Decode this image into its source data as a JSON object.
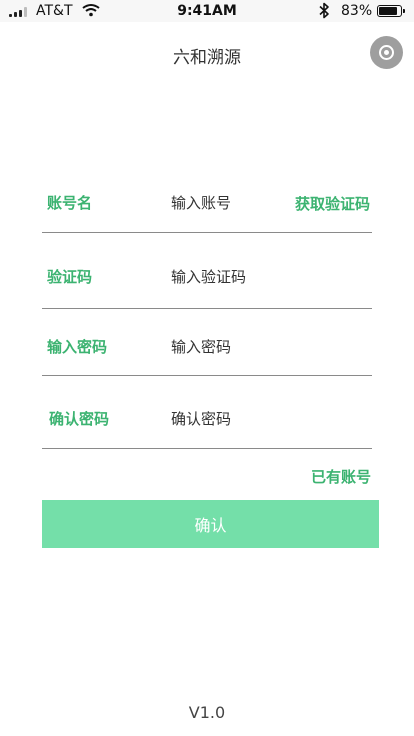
{
  "status_bar": {
    "carrier": "AT&T",
    "time": "9:41AM",
    "battery_percent": "83%",
    "battery_level": 0.83,
    "icons": [
      "signal-icon",
      "wifi-icon",
      "bluetooth-icon",
      "battery-icon"
    ]
  },
  "nav": {
    "title": "六和溯源",
    "right_icon": "record-icon"
  },
  "form": {
    "account": {
      "label": "账号名",
      "placeholder": "输入账号",
      "value": ""
    },
    "get_code_label": "获取验证码",
    "code": {
      "label": "验证码",
      "placeholder": "输入验证码",
      "value": ""
    },
    "password": {
      "label": "输入密码",
      "placeholder": "输入密码",
      "value": ""
    },
    "confirm_password": {
      "label": "确认密码",
      "placeholder": "确认密码",
      "value": ""
    },
    "has_account_label": "已有账号",
    "confirm_label": "确认"
  },
  "footer": {
    "version": "V1.0"
  },
  "colors": {
    "accent": "#3cb371",
    "button_bg": "#74dfa9",
    "divider": "#8a8a8a"
  }
}
